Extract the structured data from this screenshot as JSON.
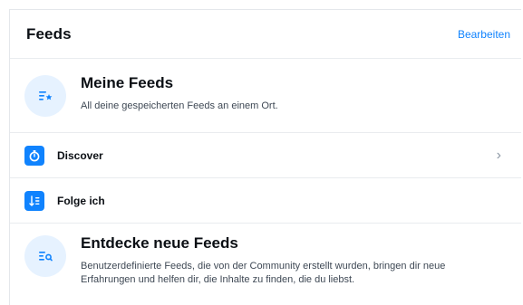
{
  "header": {
    "title": "Feeds",
    "edit_label": "Bearbeiten"
  },
  "my_feeds": {
    "title": "Meine Feeds",
    "description": "All deine gespeicherten Feeds an einem Ort.",
    "icon": "saved-feeds-icon"
  },
  "rows": [
    {
      "label": "Discover",
      "icon": "discover-icon"
    },
    {
      "label": "Folge ich",
      "icon": "following-icon"
    }
  ],
  "discover_feeds": {
    "title": "Entdecke neue Feeds",
    "description": "Benutzerdefinierte Feeds, die von der Community erstellt wurden, bringen dir neue Erfahrungen und helfen dir, die Inhalte zu finden, die du liebst.",
    "icon": "feed-search-icon"
  },
  "colors": {
    "accent": "#1083fe",
    "icon_circle_bg": "#e6f2ff"
  }
}
